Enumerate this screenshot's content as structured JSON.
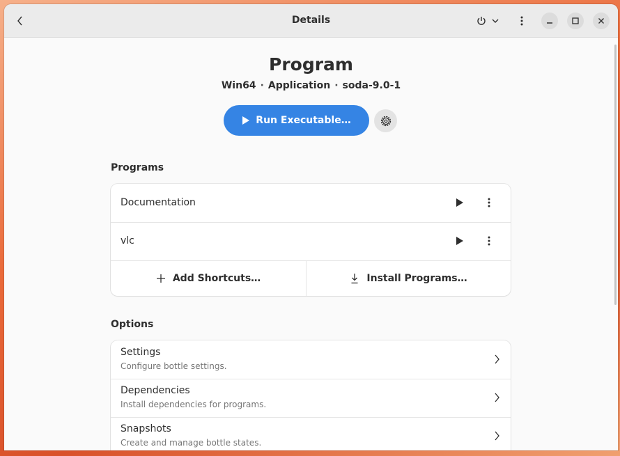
{
  "window": {
    "title": "Details",
    "controls": {
      "minimize": "minimize-icon",
      "maximize": "maximize-icon",
      "close": "close-icon"
    }
  },
  "header": {
    "back_icon": "chevron-left-icon",
    "power_icon": "power-icon",
    "dropdown_icon": "chevron-down-icon",
    "menu_icon": "kebab-menu-icon"
  },
  "bottle": {
    "name": "Program",
    "arch": "Win64",
    "sep1": "·",
    "environment": "Application",
    "sep2": "·",
    "runner": "soda-9.0-1"
  },
  "run_button": {
    "label": "Run Executable…",
    "icon": "play-icon"
  },
  "settings_gear": {
    "icon": "gear-icon"
  },
  "programs": {
    "heading": "Programs",
    "items": [
      {
        "label": "Documentation"
      },
      {
        "label": "vlc"
      }
    ],
    "add_shortcuts": {
      "label": "Add Shortcuts…",
      "icon": "plus-icon"
    },
    "install_programs": {
      "label": "Install Programs…",
      "icon": "download-icon"
    }
  },
  "options": {
    "heading": "Options",
    "items": [
      {
        "title": "Settings",
        "description": "Configure bottle settings."
      },
      {
        "title": "Dependencies",
        "description": "Install dependencies for programs."
      },
      {
        "title": "Snapshots",
        "description": "Create and manage bottle states."
      }
    ]
  },
  "colors": {
    "accent": "#3584e4",
    "window_bg": "#fafafa",
    "headerbar_bg": "#ebebeb"
  }
}
